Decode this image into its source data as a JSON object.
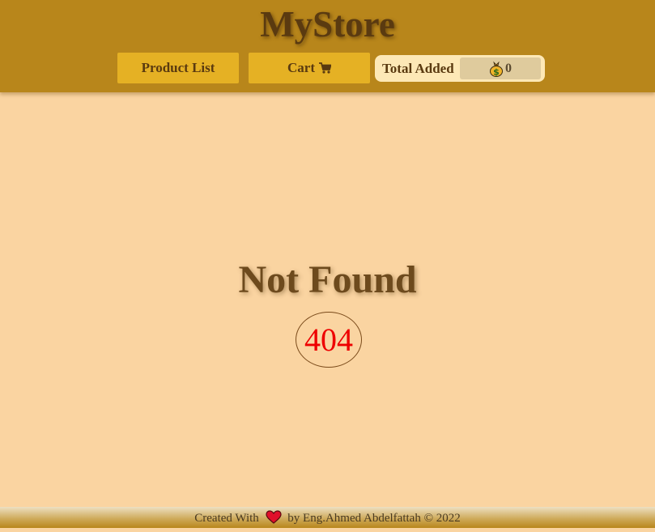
{
  "header": {
    "brand": "MyStore",
    "nav": {
      "product_list_label": "Product List",
      "cart_label": "Cart",
      "cart_icon": "cart-icon"
    },
    "total": {
      "label": "Total Added",
      "icon": "money-bag-icon",
      "value": "0"
    }
  },
  "main": {
    "title": "Not Found",
    "code": "404"
  },
  "footer": {
    "before": "Created With",
    "icon": "heart-icon",
    "after": "by Eng.Ahmed Abdelfattah © 2022"
  },
  "colors": {
    "header_bg": "#b8861b",
    "button_bg": "#e5b124",
    "page_bg": "#fad4a1",
    "brand_text": "#5a3a10",
    "error_code": "#ee0000"
  }
}
